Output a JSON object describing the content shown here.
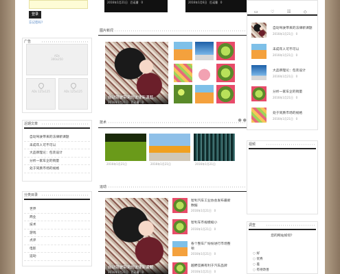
{
  "login": {
    "button": "登录",
    "forgot": "忘记密码?"
  },
  "ads": {
    "big_text": "AD\n300x250",
    "big_line1": "ADs",
    "big_line2": "300x250",
    "small_text": "ADs 125x125"
  },
  "sections": {
    "recent_posts": "近期文章",
    "category": "分类目录",
    "pic_news": "图片新闻",
    "tech": "技术",
    "sport": "运动",
    "video": "视频",
    "survey": "调查"
  },
  "recent_posts": [
    "自动驾驶带来的法律新课题",
    "未成年人可不可以",
    "大品牌理论：包装设计",
    "分析一家车企的销量",
    "处于同质市场的规格"
  ],
  "categories": [
    "世界",
    "商业",
    "技术",
    "游戏",
    "点评",
    "电影",
    "运动"
  ],
  "top_meta": [
    {
      "date": "2016年1月21日",
      "comments": "0"
    },
    {
      "date": "2016年1月6日",
      "comments": "0"
    }
  ],
  "pic_feature": {
    "title": "自动驾驶带来的法律新课题",
    "date": "2016年1月21日",
    "author": "匹诺曹",
    "comments": "0"
  },
  "tech_items": [
    {
      "date": "2016年1月21日"
    },
    {
      "date": "2016年1月21日"
    },
    {
      "date": "2016年1月21日"
    }
  ],
  "sport_feature": {
    "title": "自动驾驶带来的法律新课题",
    "date": "2016年1月21日",
    "author": "匹诺曹",
    "comments": "0"
  },
  "sport_items": [
    {
      "title": "智利汽车工业协会发布最新",
      "title2": "数据",
      "date": "2016年1月21日",
      "comments": "0"
    },
    {
      "title": "智利车市规模缩小",
      "date": "2016年1月21日",
      "comments": "0"
    },
    {
      "title": "各个整车厂纷纷进行市场整",
      "title2": "顿",
      "date": "2016年1月21日",
      "comments": "0"
    },
    {
      "title": "越野竞赛有利于汽车品牌",
      "date": "2016年1月21日",
      "comments": "0"
    }
  ],
  "side_items": [
    {
      "title": "自动驾驶带来的法律新课题",
      "date": "2016年1月21日",
      "comments": "0"
    },
    {
      "title": "未成年人可不可以",
      "date": "2016年1月21日",
      "comments": "0"
    },
    {
      "title": "大品牌理论：包装设计",
      "date": "2016年1月21日",
      "comments": "0"
    },
    {
      "title": "分析一家车企的销量",
      "date": "2016年1月21日",
      "comments": "0"
    },
    {
      "title": "处于同质市场的规格",
      "date": "2016年1月21日",
      "comments": "0"
    }
  ],
  "poll": {
    "question": "您的网站如何？",
    "options": [
      "好",
      "优秀",
      "差",
      "有待改善"
    ]
  }
}
